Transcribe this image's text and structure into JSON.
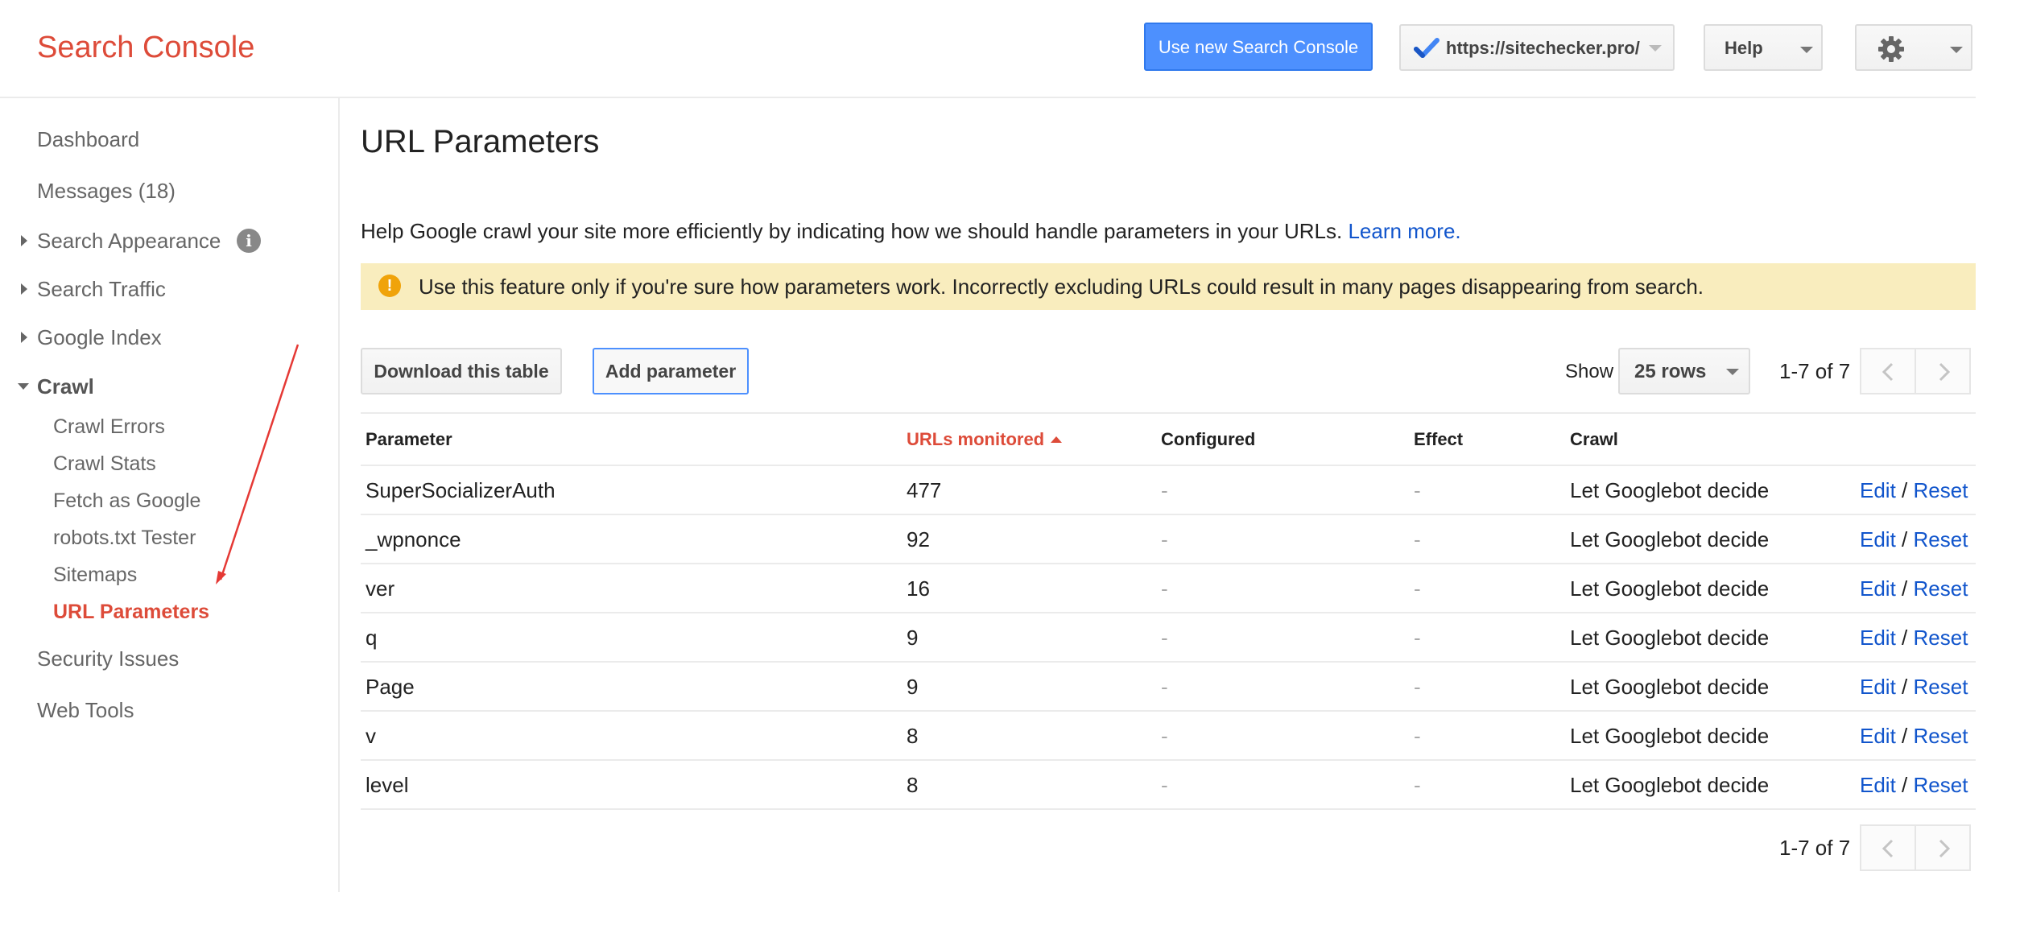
{
  "header": {
    "app_title": "Search Console",
    "new_console_label": "Use new Search Console",
    "site_url": "https://sitechecker.pro/",
    "help_label": "Help",
    "settings_icon": "gear-icon"
  },
  "sidebar": {
    "items": [
      {
        "label": "Dashboard"
      },
      {
        "label": "Messages (18)"
      },
      {
        "label": "Search Appearance"
      },
      {
        "label": "Search Traffic"
      },
      {
        "label": "Google Index"
      },
      {
        "label": "Crawl"
      },
      {
        "label": "Crawl Errors"
      },
      {
        "label": "Crawl Stats"
      },
      {
        "label": "Fetch as Google"
      },
      {
        "label": "robots.txt Tester"
      },
      {
        "label": "Sitemaps"
      },
      {
        "label": "URL Parameters"
      },
      {
        "label": "Security Issues"
      },
      {
        "label": "Web Tools"
      }
    ],
    "active_item": "URL Parameters"
  },
  "main": {
    "title": "URL Parameters",
    "intro_text": "Help Google crawl your site more efficiently by indicating how we should handle parameters in your URLs.",
    "learn_more": "Learn more.",
    "warning_text": "Use this feature only if you're sure how parameters work. Incorrectly excluding URLs could result in many pages disappearing from search.",
    "download_label": "Download this table",
    "add_label": "Add parameter",
    "show_label": "Show",
    "rows_value": "25 rows",
    "page_count": "1-7 of 7"
  },
  "table": {
    "columns": [
      "Parameter",
      "URLs monitored",
      "Configured",
      "Effect",
      "Crawl"
    ],
    "sorted_column": "URLs monitored",
    "edit_label": "Edit",
    "separator": "/",
    "reset_label": "Reset",
    "rows": [
      {
        "parameter": "SuperSocializerAuth",
        "urls": "477",
        "configured": "-",
        "effect": "-",
        "crawl": "Let Googlebot decide"
      },
      {
        "parameter": "_wpnonce",
        "urls": "92",
        "configured": "-",
        "effect": "-",
        "crawl": "Let Googlebot decide"
      },
      {
        "parameter": "ver",
        "urls": "16",
        "configured": "-",
        "effect": "-",
        "crawl": "Let Googlebot decide"
      },
      {
        "parameter": "q",
        "urls": "9",
        "configured": "-",
        "effect": "-",
        "crawl": "Let Googlebot decide"
      },
      {
        "parameter": "Page",
        "urls": "9",
        "configured": "-",
        "effect": "-",
        "crawl": "Let Googlebot decide"
      },
      {
        "parameter": "v",
        "urls": "8",
        "configured": "-",
        "effect": "-",
        "crawl": "Let Googlebot decide"
      },
      {
        "parameter": "level",
        "urls": "8",
        "configured": "-",
        "effect": "-",
        "crawl": "Let Googlebot decide"
      }
    ]
  },
  "colors": {
    "brand_red": "#dd4b39",
    "link_blue": "#1155cc",
    "button_blue": "#4d90fe",
    "warning_bg": "#f9edbe",
    "annotation_arrow": "#e53935"
  }
}
